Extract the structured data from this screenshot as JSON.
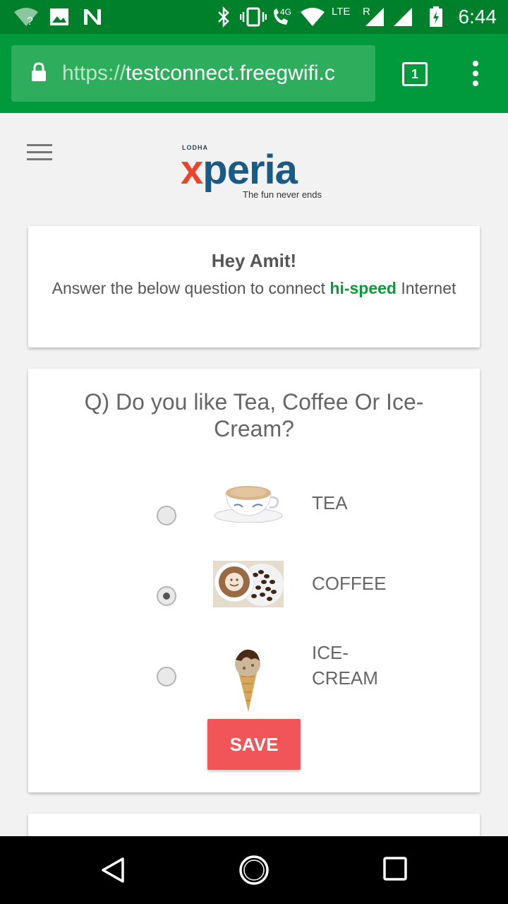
{
  "status_bar": {
    "time": "6:44",
    "network": "4G",
    "lte": "LTE",
    "roaming": "R"
  },
  "browser": {
    "url_scheme": "https://",
    "url_host": "testconnect.freegwifi.c",
    "tab_count": "1"
  },
  "logo": {
    "small_text": "LODHA",
    "brand_x": "x",
    "brand_rest": "peria",
    "tagline": "The fun never ends"
  },
  "greeting": {
    "title": "Hey Amit!",
    "msg_before": "Answer the below question to connect ",
    "msg_highlight": "hi-speed",
    "msg_after": " Internet"
  },
  "question": {
    "text": "Q) Do you like Tea, Coffee Or Ice-Cream?",
    "options": [
      {
        "label": "TEA",
        "image": "tea-cup-image",
        "selected": false
      },
      {
        "label": "COFFEE",
        "image": "coffee-cup-image",
        "selected": true
      },
      {
        "label": "ICE-CREAM",
        "image": "ice-cream-cone-image",
        "selected": false
      }
    ],
    "save_label": "SAVE"
  },
  "colors": {
    "status_bar": "#00802b",
    "toolbar": "#009a3c",
    "highlight": "#0a9a3a",
    "save_button": "#f25557"
  }
}
